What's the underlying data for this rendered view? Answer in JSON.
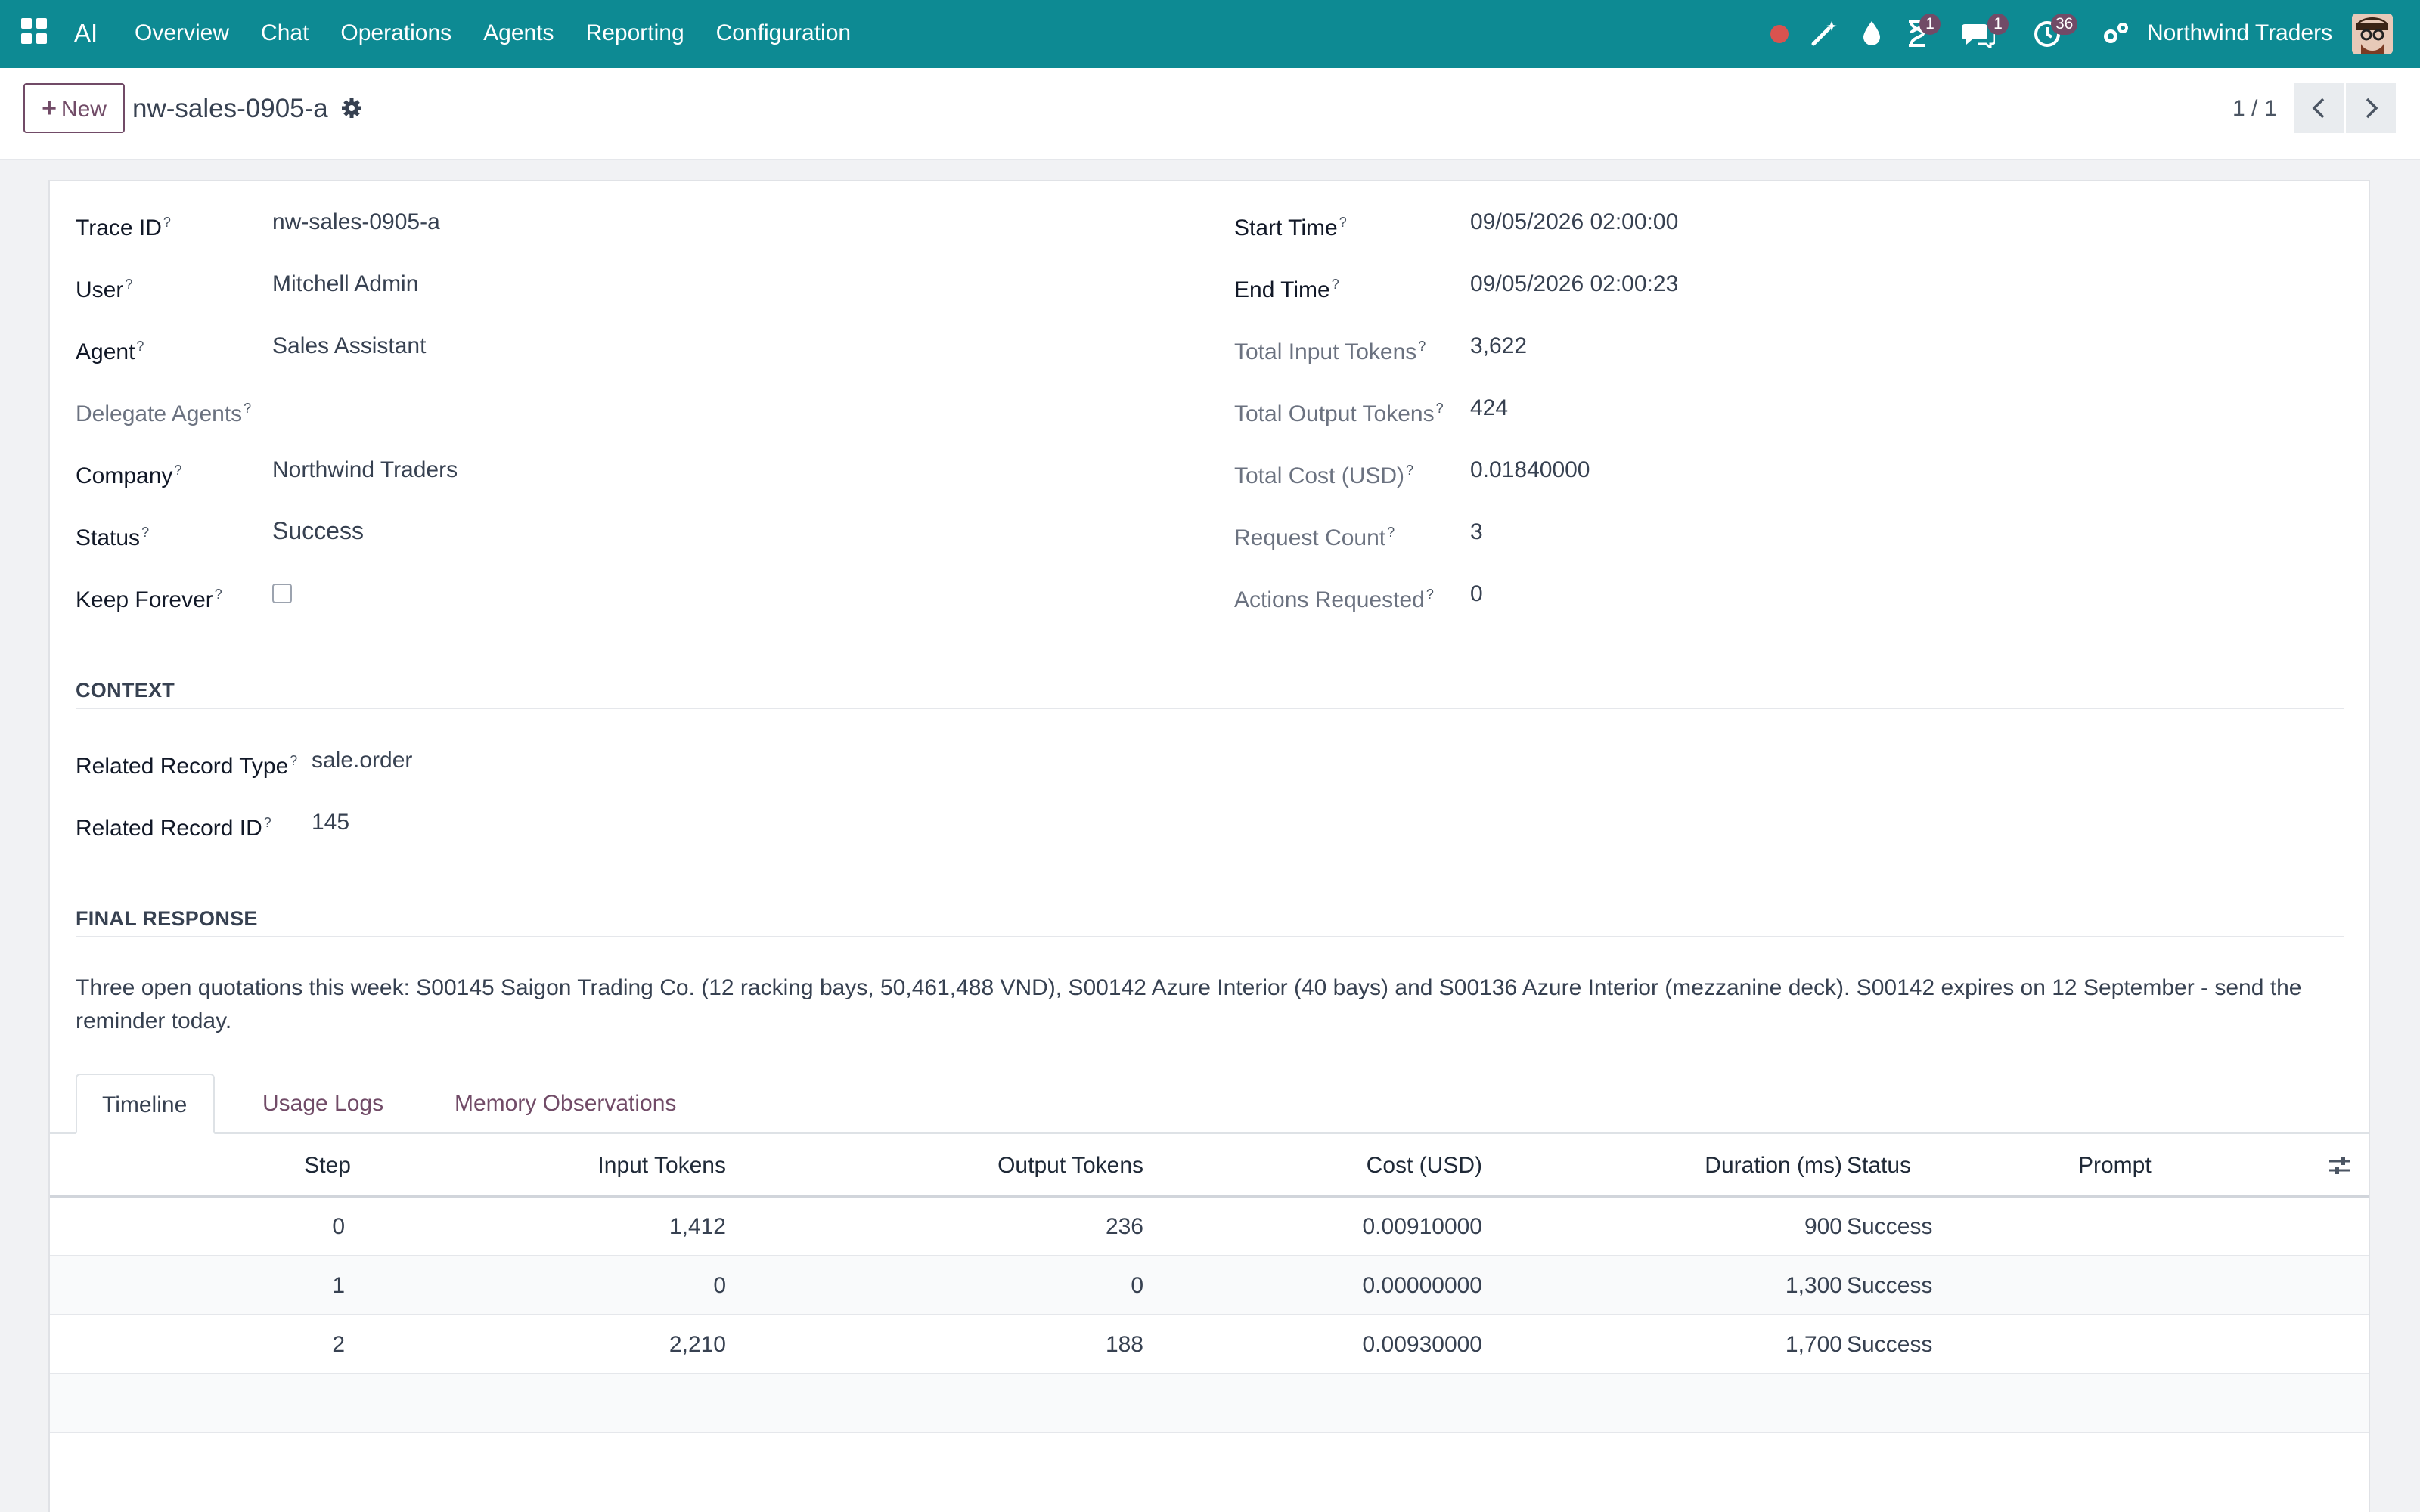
{
  "navbar": {
    "brand": "AI",
    "menu": [
      "Overview",
      "Chat",
      "Operations",
      "Agents",
      "Reporting",
      "Configuration"
    ],
    "badges": {
      "activity": "1",
      "messages": "1",
      "clock": "36"
    },
    "company": "Northwind Traders",
    "icons": [
      "apps-grid-icon",
      "record-dot-icon",
      "magic-wand-icon",
      "drop-icon",
      "hourglass-icon",
      "chat-bubbles-icon",
      "clock-icon",
      "settings-gears-icon"
    ]
  },
  "control_panel": {
    "new_label": "New",
    "record_title": "nw-sales-0905-a",
    "pager_value": "1 / 1"
  },
  "form": {
    "left": [
      {
        "label": "Trace ID",
        "value": "nw-sales-0905-a"
      },
      {
        "label": "User",
        "value": "Mitchell Admin"
      },
      {
        "label": "Agent",
        "value": "Sales Assistant"
      },
      {
        "label": "Delegate Agents",
        "value": ""
      },
      {
        "label": "Company",
        "value": "Northwind Traders"
      },
      {
        "label": "Status",
        "value": "Success"
      },
      {
        "label": "Keep Forever",
        "value": ""
      }
    ],
    "right": [
      {
        "label": "Start Time",
        "value": "09/05/2026 02:00:00"
      },
      {
        "label": "End Time",
        "value": "09/05/2026 02:00:23"
      },
      {
        "label": "Total Input Tokens",
        "value": "3,622"
      },
      {
        "label": "Total Output Tokens",
        "value": "424"
      },
      {
        "label": "Total Cost (USD)",
        "value": "0.01840000"
      },
      {
        "label": "Request Count",
        "value": "3"
      },
      {
        "label": "Actions Requested",
        "value": "0"
      }
    ],
    "help_mark": "?",
    "keep_forever_checked": false
  },
  "context": {
    "title": "CONTEXT",
    "fields": [
      {
        "label": "Related Record Type",
        "value": "sale.order"
      },
      {
        "label": "Related Record ID",
        "value": "145"
      }
    ]
  },
  "final_response": {
    "title": "FINAL RESPONSE",
    "text": "Three open quotations this week: S00145 Saigon Trading Co. (12 racking bays, 50,461,488 VND), S00142 Azure Interior (40 bays) and S00136 Azure Interior (mezzanine deck). S00142 expires on 12 September - send the reminder today."
  },
  "tabs": [
    "Timeline",
    "Usage Logs",
    "Memory Observations"
  ],
  "timeline": {
    "columns": [
      "Step",
      "Input Tokens",
      "Output Tokens",
      "Cost (USD)",
      "Duration (ms)",
      "Status",
      "Prompt"
    ],
    "rows": [
      {
        "step": "0",
        "input": "1,412",
        "output": "236",
        "cost": "0.00910000",
        "duration": "900",
        "status": "Success",
        "prompt": ""
      },
      {
        "step": "1",
        "input": "0",
        "output": "0",
        "cost": "0.00000000",
        "duration": "1,300",
        "status": "Success",
        "prompt": ""
      },
      {
        "step": "2",
        "input": "2,210",
        "output": "188",
        "cost": "0.00930000",
        "duration": "1,700",
        "status": "Success",
        "prompt": ""
      }
    ]
  },
  "colors": {
    "navbar": "#0d8a93",
    "accent": "#714b67",
    "record_dot": "#d9534f"
  }
}
